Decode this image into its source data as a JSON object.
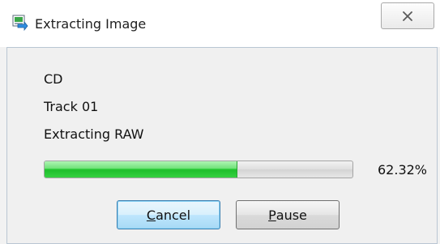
{
  "window": {
    "title": "Extracting Image",
    "icon": "extract-image-app-icon",
    "close_icon": "close-x-icon"
  },
  "status": {
    "disc": "CD",
    "track": "Track 01",
    "mode": "Extracting RAW"
  },
  "progress": {
    "value": 0.6232,
    "label": "62.32%"
  },
  "buttons": {
    "cancel": {
      "accesskey": "C",
      "rest": "ancel"
    },
    "pause": {
      "accesskey": "P",
      "rest": "ause"
    }
  },
  "colors": {
    "progress_fill": "#2fcb3b",
    "focused_button_border": "#3c7fb1"
  }
}
